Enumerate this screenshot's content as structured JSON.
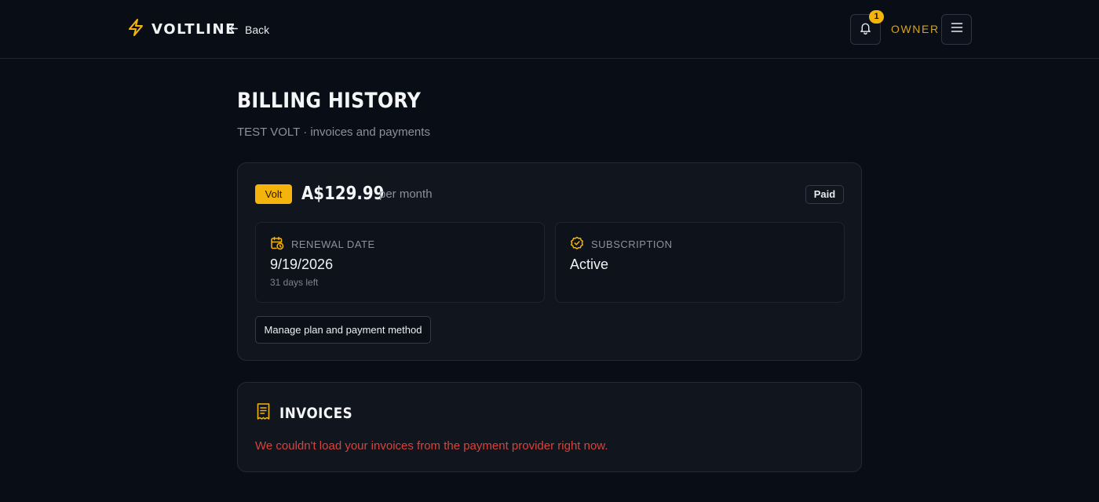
{
  "header": {
    "brand": "VOLTLINE",
    "back_label": "Back",
    "notification_count": "1",
    "role": "OWNER"
  },
  "page": {
    "title": "BILLING HISTORY",
    "subtitle": "TEST VOLT · invoices and payments"
  },
  "plan": {
    "badge": "Volt",
    "price": "A$129.99",
    "period": "per month",
    "status": "Paid",
    "renewal": {
      "label": "RENEWAL DATE",
      "value": "9/19/2026",
      "note": "31 days left"
    },
    "subscription": {
      "label": "SUBSCRIPTION",
      "value": "Active"
    },
    "manage_button": "Manage plan and payment method"
  },
  "invoices": {
    "title": "INVOICES",
    "error": "We couldn't load your invoices from the payment provider right now."
  },
  "colors": {
    "accent": "#f5b40b",
    "background": "#090e16",
    "card": "#10151e",
    "error": "#d5443c"
  },
  "icons": {
    "logo": "lightning-bolt-icon",
    "back": "arrow-left-icon",
    "notifications": "bell-icon",
    "menu": "hamburger-menu-icon",
    "renewal": "calendar-clock-icon",
    "subscription": "check-badge-icon",
    "invoices": "receipt-icon"
  }
}
